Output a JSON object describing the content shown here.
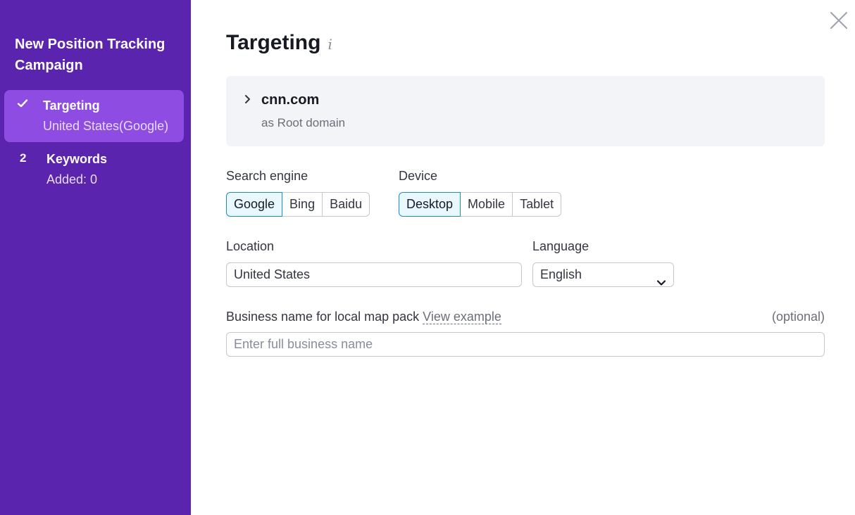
{
  "sidebar": {
    "title": "New Position Tracking Campaign",
    "steps": [
      {
        "marker": "check-icon",
        "label": "Targeting",
        "sub": "United States(Google)",
        "active": true
      },
      {
        "marker": "2",
        "label": "Keywords",
        "sub": "Added: 0",
        "active": false
      }
    ]
  },
  "main": {
    "title": "Targeting",
    "info_icon": "i",
    "domain": {
      "name": "cnn.com",
      "type": "as Root domain"
    },
    "search_engine": {
      "label": "Search engine",
      "options": [
        "Google",
        "Bing",
        "Baidu"
      ],
      "selected": "Google"
    },
    "device": {
      "label": "Device",
      "options": [
        "Desktop",
        "Mobile",
        "Tablet"
      ],
      "selected": "Desktop"
    },
    "location": {
      "label": "Location",
      "value": "United States"
    },
    "language": {
      "label": "Language",
      "value": "English"
    },
    "business": {
      "label": "Business name for local map pack",
      "link": "View example",
      "optional": "(optional)",
      "placeholder": "Enter full business name"
    }
  },
  "colors": {
    "sidebar_bg": "#5b24ae",
    "active_step_bg": "#8e4ce3",
    "selected_border": "#1b8ad7",
    "selected_bg": "#e9f7ff"
  },
  "icons": {
    "close": "close-icon",
    "domain_toggle": "chevron-right-icon",
    "language_toggle": "chevron-down-icon",
    "step_done": "check-icon"
  }
}
